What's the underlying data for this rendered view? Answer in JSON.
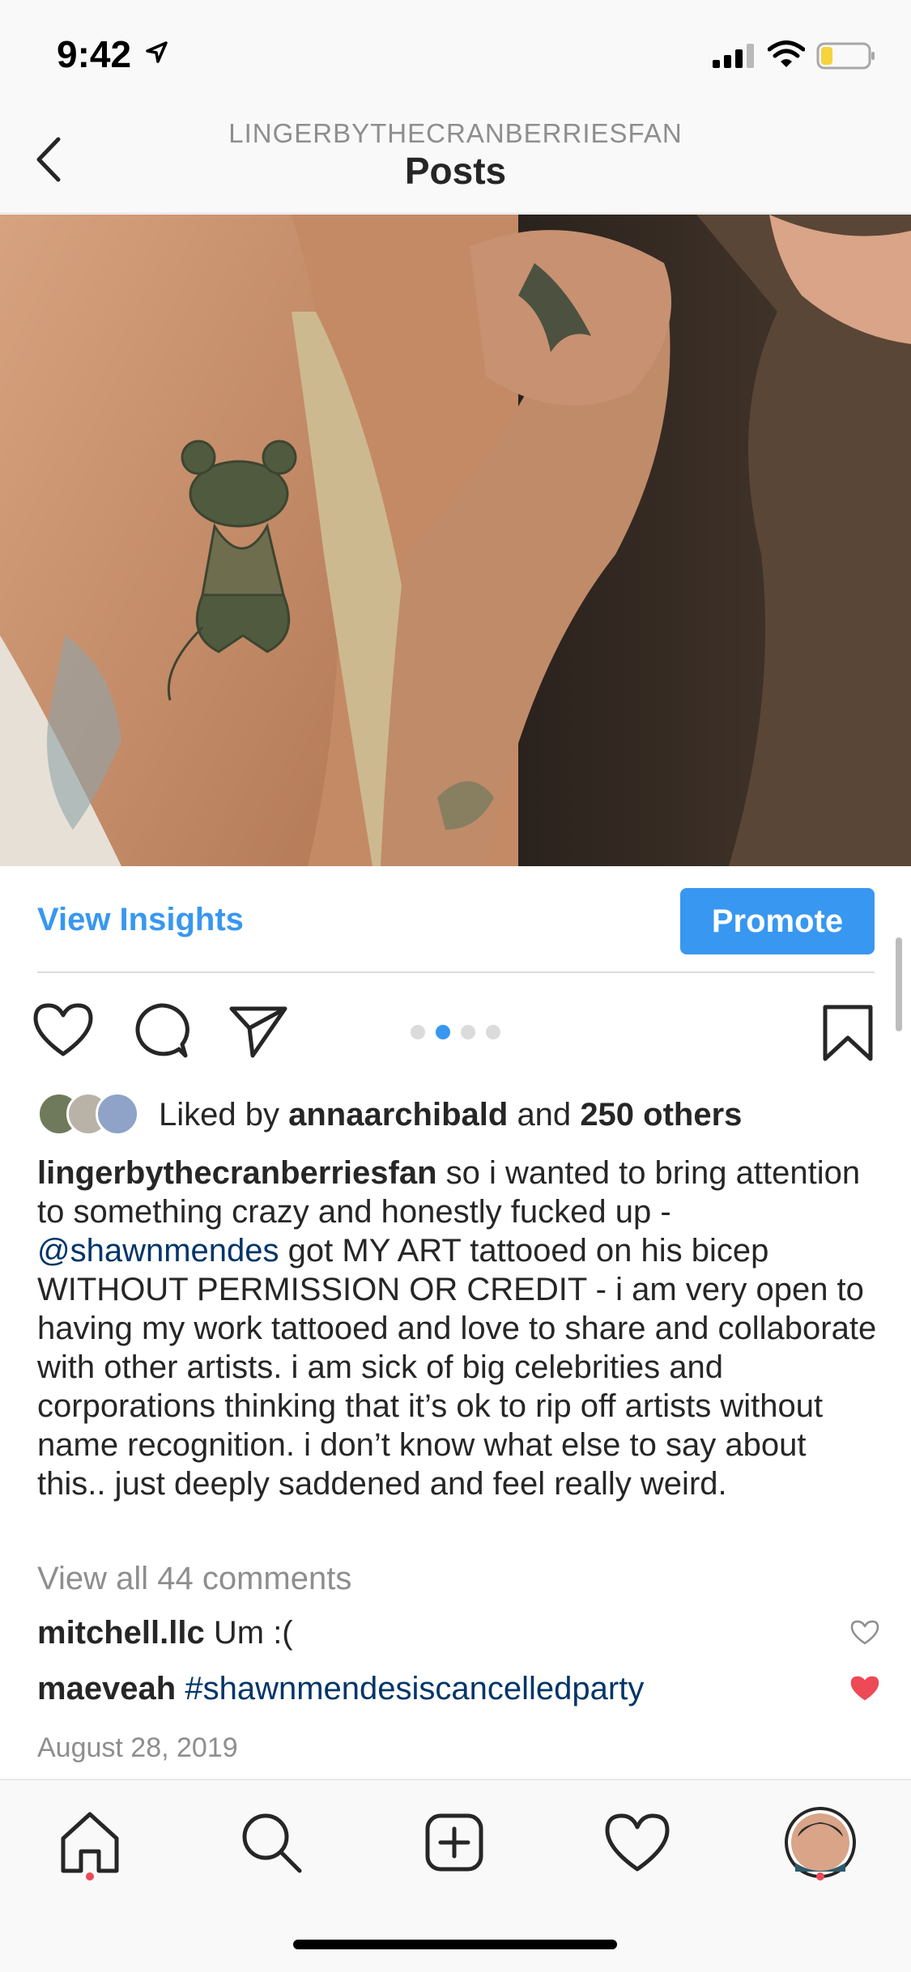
{
  "status_bar": {
    "time": "9:42"
  },
  "nav": {
    "subtitle": "LINGERBYTHECRANBERRIESFAN",
    "title": "Posts"
  },
  "insights": {
    "view_label": "View Insights",
    "promote_label": "Promote"
  },
  "carousel": {
    "total": 4,
    "active_index": 1
  },
  "likes": {
    "prefix": "Liked by",
    "user": "annaarchibald",
    "middle": "and",
    "others": "250 others"
  },
  "caption": {
    "username": "lingerbythecranberriesfan",
    "text_1": "so i wanted to bring attention to something crazy and honestly fucked up -",
    "mention": "@shawnmendes",
    "text_2": "got MY ART tattooed on his bicep WITHOUT PERMISSION OR CREDIT - i am very open to having my work tattooed and love to share and collaborate with other artists. i am sick of big celebrities and corporations thinking that it’s ok to rip off artists without name recognition. i don’t know what else to say about this.. just deeply saddened and feel really weird."
  },
  "comments": {
    "view_all": "View all 44 comments",
    "items": [
      {
        "user": "mitchell.llc",
        "text": "Um :(",
        "liked": false
      },
      {
        "user": "maeveah",
        "text": "#shawnmendesiscancelledparty",
        "liked": true
      }
    ]
  },
  "post_date": "August 28, 2019",
  "colors": {
    "accent": "#3897f0",
    "heart": "#ed4956",
    "link": "#003569"
  },
  "tab_bar": {
    "items": [
      "home-icon",
      "search-icon",
      "new-post-icon",
      "activity-heart-icon",
      "profile-avatar"
    ]
  }
}
